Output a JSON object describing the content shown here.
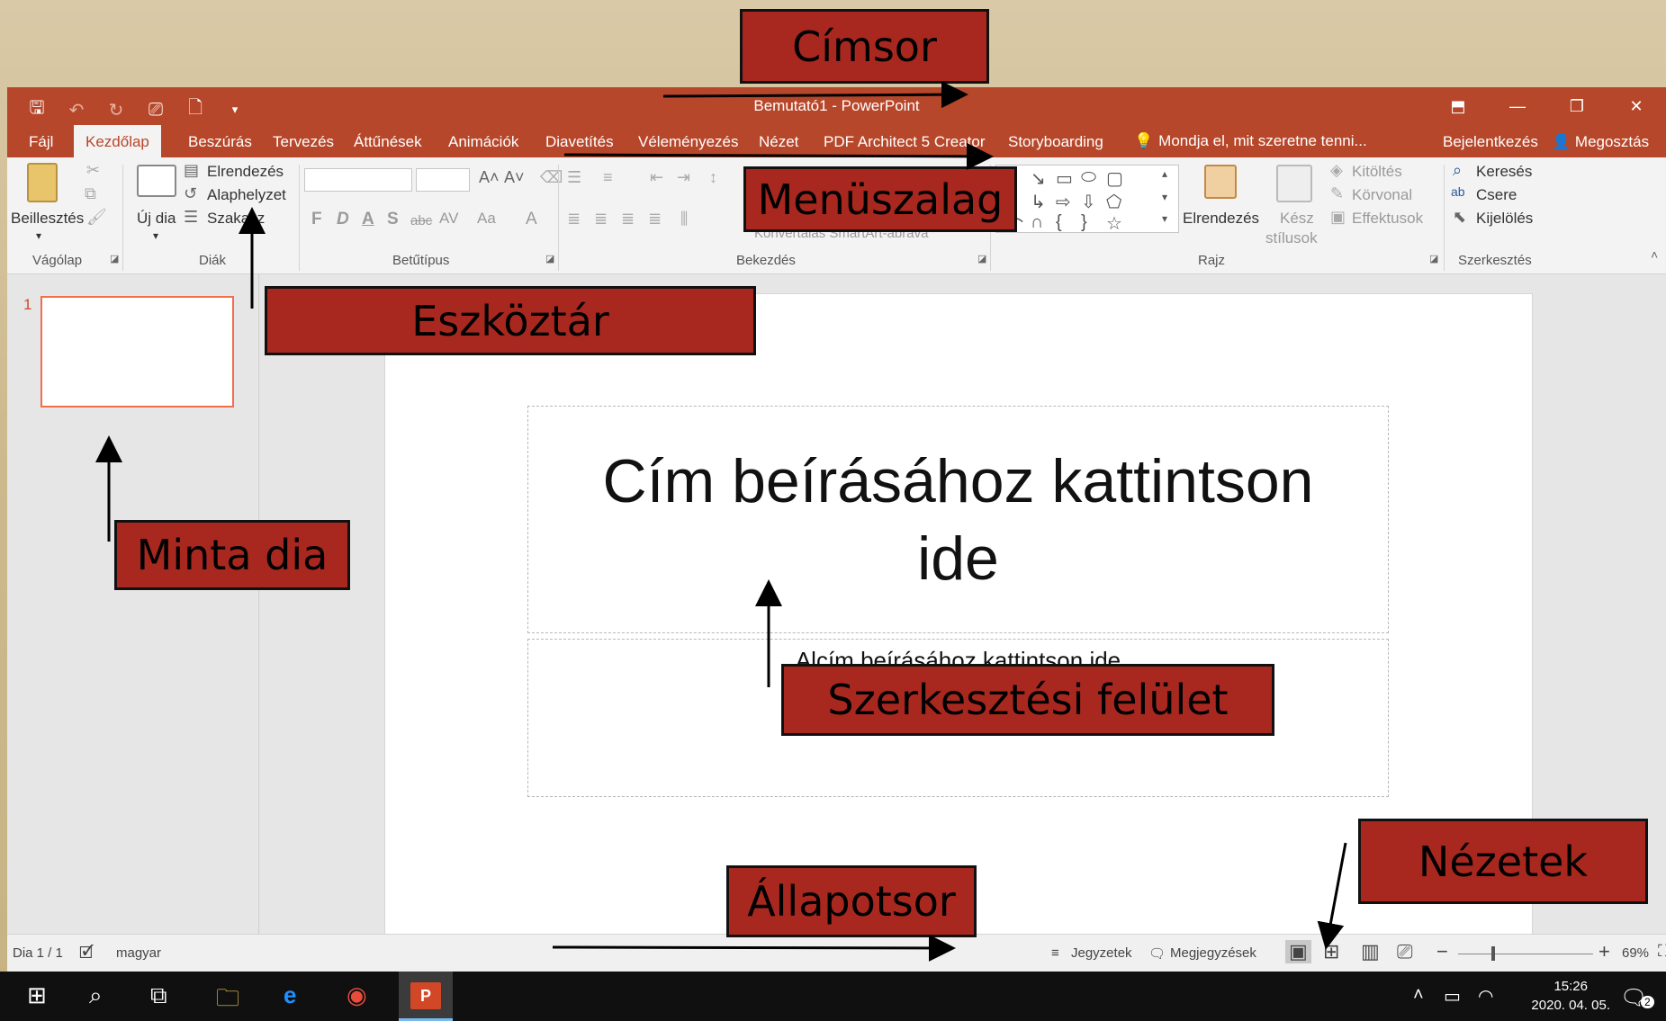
{
  "window": {
    "title": "Bemutató1 - PowerPoint",
    "controls": [
      "⬒",
      "—",
      "❐",
      "✕"
    ]
  },
  "tabs": [
    "Fájl",
    "Kezdőlap",
    "Beszúrás",
    "Tervezés",
    "Áttűnések",
    "Animációk",
    "Diavetítés",
    "Véleményezés",
    "Nézet",
    "PDF Architect 5 Creator",
    "Storyboarding"
  ],
  "tell_me": "Mondja el, mit szeretne tenni...",
  "signin": "Bejelentkezés",
  "share": "Megosztás",
  "ribbon": {
    "paste_label": "Beillesztés",
    "new_slide_label": "Új dia",
    "layout_label": "Elrendezés",
    "reset_label": "Alaphelyzet",
    "section_label": "Szakasz",
    "format_letters": [
      "F",
      "D",
      "A",
      "S",
      "abc",
      "AV",
      "Aa",
      "A"
    ],
    "smartart_label": "Konvertálás SmartArt-ábrává",
    "arrange_label": "Elrendezés",
    "quick_styles_label": [
      "Kész",
      "stílusok"
    ],
    "fill_label": "Kitöltés",
    "outline_label": "Körvonal",
    "effects_label": "Effektusok",
    "find_label": "Keresés",
    "replace_label": "Csere",
    "select_label": "Kijelölés",
    "groups": [
      "Vágólap",
      "Diák",
      "Betűtípus",
      "Bekezdés",
      "Rajz",
      "Szerkesztés"
    ]
  },
  "thumbnail_number": "1",
  "slide": {
    "title_placeholder": "Cím beírásához kattintson ide",
    "subtitle_placeholder": "Alcím beírásához kattintson ide"
  },
  "status": {
    "slide_counter": "Dia 1 / 1",
    "language": "magyar",
    "notes": "Jegyzetek",
    "comments": "Megjegyzések",
    "zoom": "69%"
  },
  "taskbar": {
    "time": "15:26",
    "date": "2020. 04. 05.",
    "notification_count": "2"
  },
  "annotations": {
    "title_bar": "Címsor",
    "ribbon": "Menüszalag",
    "toolbar": "Eszköztár",
    "sample_slide": "Minta dia",
    "edit_area": "Szerkesztési felület",
    "status_bar": "Állapotsor",
    "views": "Nézetek"
  },
  "colors": {
    "ppt_accent": "#b7472a",
    "label_fill": "#a8281f",
    "background": "#d9c9a6"
  }
}
